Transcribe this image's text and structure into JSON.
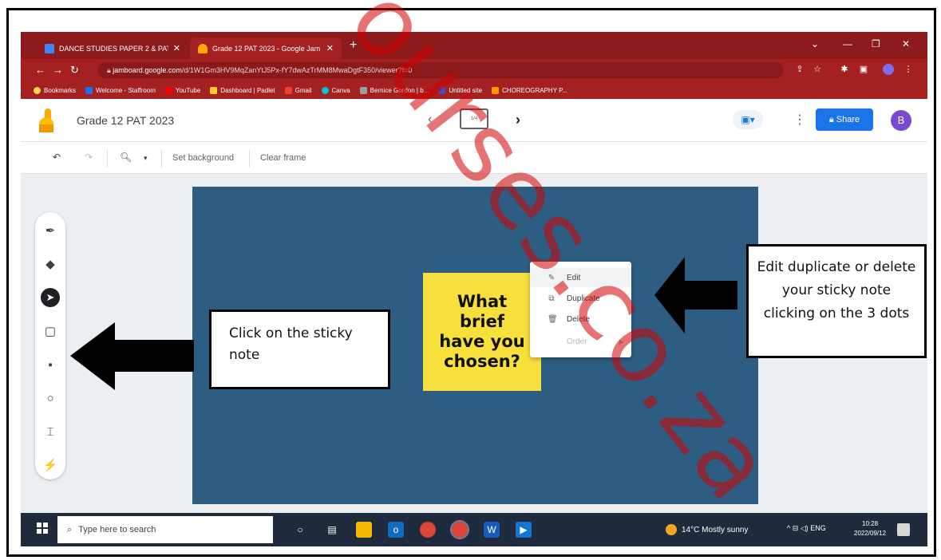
{
  "browser": {
    "tabs": [
      {
        "title": "DANCE STUDIES PAPER 2 & PAT",
        "active": false,
        "favicon_color": "#4285f4"
      },
      {
        "title": "Grade 12 PAT 2023 - Google Jam",
        "active": true,
        "favicon_color": "#f9ab00"
      }
    ],
    "address": {
      "host": "jamboard.google.com",
      "path": "/d/1W1Gm3HV9MqZanYtJ5Px-fY7dwAzTrMM8MwaDgtF350/viewer?f=0"
    },
    "bookmarks": [
      {
        "label": "Bookmarks",
        "color": "#ffd54f"
      },
      {
        "label": "Welcome - Staffroom",
        "color": "#1a73e8"
      },
      {
        "label": "YouTube",
        "color": "#ff0000"
      },
      {
        "label": "Dashboard | Padlet",
        "color": "#ffca28"
      },
      {
        "label": "Gmail",
        "color": "#ea4335"
      },
      {
        "label": "Canva",
        "color": "#00c4cc"
      },
      {
        "label": "Bernice Gordon | b...",
        "color": "#5f6368"
      },
      {
        "label": "Untitled site",
        "color": "#3f51b5"
      },
      {
        "label": "CHOREOGRAPHY P...",
        "color": "#ff9800"
      }
    ]
  },
  "app": {
    "title": "Grade 12 PAT 2023",
    "frame_counter": "1/4",
    "share_label": "Share",
    "avatar_letter": "B",
    "subtoolbar": {
      "set_background": "Set background",
      "clear_frame": "Clear frame"
    }
  },
  "sticky_note": {
    "text": "What brief have you chosen?",
    "color": "#f7e03b"
  },
  "context_menu": {
    "items": [
      {
        "label": "Edit",
        "icon": "pencil-icon",
        "disabled": false
      },
      {
        "label": "Duplicate",
        "icon": "copy-icon",
        "disabled": false
      },
      {
        "label": "Delete",
        "icon": "trash-icon",
        "disabled": false
      },
      {
        "label": "Order",
        "icon": "",
        "disabled": true
      }
    ]
  },
  "annotations": {
    "left": "Click on the sticky note",
    "right": "Edit duplicate or delete your sticky note clicking on the 3 dots"
  },
  "taskbar": {
    "search_placeholder": "Type here to search",
    "weather": "14°C  Mostly sunny",
    "language": "ENG",
    "time": "10:28",
    "date": "2022/09/12"
  },
  "watermark": "ourses.co.za",
  "colors": {
    "chrome_red": "#a52020",
    "board_blue": "#2d5d82",
    "share_blue": "#1a73e8"
  }
}
